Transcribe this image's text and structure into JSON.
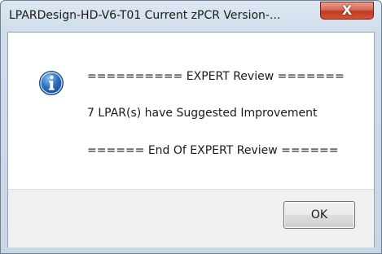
{
  "window": {
    "title": "LPARDesign-HD-V6-T01    Current zPCR Version-..."
  },
  "titlebar": {
    "close_icon": "close-icon",
    "close_color": "#c0391f"
  },
  "dialog": {
    "icon": "info-icon",
    "icon_color": "#2a6fc0",
    "lines": [
      "========== EXPERT Review =======",
      "7 LPAR(s) have Suggested Improvement",
      "====== End Of EXPERT Review ======"
    ]
  },
  "buttons": {
    "ok_label": "OK"
  }
}
